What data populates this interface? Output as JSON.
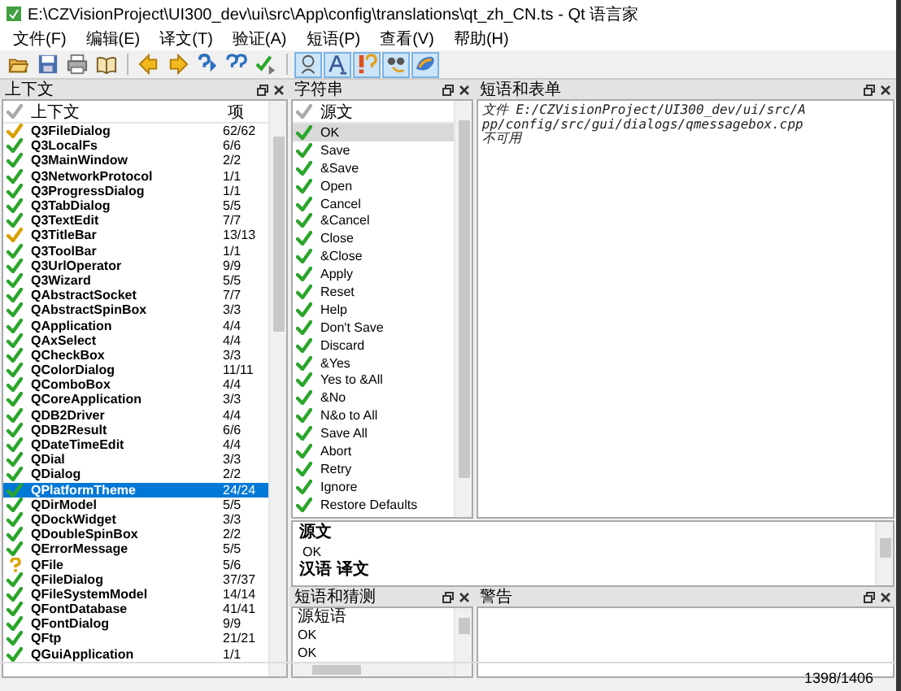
{
  "window": {
    "title": "E:\\CZVisionProject\\UI300_dev\\ui\\src\\App\\config\\translations\\qt_zh_CN.ts - Qt 语言家"
  },
  "menu": [
    "文件(F)",
    "编辑(E)",
    "译文(T)",
    "验证(A)",
    "短语(P)",
    "查看(V)",
    "帮助(H)"
  ],
  "toolbar": [
    [
      {
        "kind": "open",
        "on": false
      },
      {
        "kind": "save",
        "on": false
      },
      {
        "kind": "print",
        "on": false
      },
      {
        "kind": "book",
        "on": false
      }
    ],
    [
      {
        "kind": "prev",
        "on": false
      },
      {
        "kind": "next",
        "on": false
      },
      {
        "kind": "prev_unfinished",
        "on": false
      },
      {
        "kind": "next_unfinished",
        "on": false
      },
      {
        "kind": "done_next",
        "on": false
      }
    ],
    [
      {
        "kind": "accelerators",
        "on": true
      },
      {
        "kind": "punctuation",
        "on": true
      },
      {
        "kind": "phrases",
        "on": true
      },
      {
        "kind": "markers",
        "on": true
      },
      {
        "kind": "whitespace",
        "on": true
      }
    ]
  ],
  "context": {
    "title": "上下文",
    "columns": [
      "上下文",
      "项"
    ],
    "rows": [
      {
        "name": "Q3FileDialog",
        "count": "62/62",
        "kind": "warning",
        "selected": false
      },
      {
        "name": "Q3LocalFs",
        "count": "6/6",
        "kind": "done",
        "selected": false
      },
      {
        "name": "Q3MainWindow",
        "count": "2/2",
        "kind": "done",
        "selected": false
      },
      {
        "name": "Q3NetworkProtocol",
        "count": "1/1",
        "kind": "done",
        "selected": false
      },
      {
        "name": "Q3ProgressDialog",
        "count": "1/1",
        "kind": "done",
        "selected": false
      },
      {
        "name": "Q3TabDialog",
        "count": "5/5",
        "kind": "done",
        "selected": false
      },
      {
        "name": "Q3TextEdit",
        "count": "7/7",
        "kind": "done",
        "selected": false
      },
      {
        "name": "Q3TitleBar",
        "count": "13/13",
        "kind": "warning",
        "selected": false
      },
      {
        "name": "Q3ToolBar",
        "count": "1/1",
        "kind": "done",
        "selected": false
      },
      {
        "name": "Q3UrlOperator",
        "count": "9/9",
        "kind": "done",
        "selected": false
      },
      {
        "name": "Q3Wizard",
        "count": "5/5",
        "kind": "done",
        "selected": false
      },
      {
        "name": "QAbstractSocket",
        "count": "7/7",
        "kind": "done",
        "selected": false
      },
      {
        "name": "QAbstractSpinBox",
        "count": "3/3",
        "kind": "done",
        "selected": false
      },
      {
        "name": "QApplication",
        "count": "4/4",
        "kind": "done",
        "selected": false
      },
      {
        "name": "QAxSelect",
        "count": "4/4",
        "kind": "done",
        "selected": false
      },
      {
        "name": "QCheckBox",
        "count": "3/3",
        "kind": "done",
        "selected": false
      },
      {
        "name": "QColorDialog",
        "count": "11/11",
        "kind": "done",
        "selected": false
      },
      {
        "name": "QComboBox",
        "count": "4/4",
        "kind": "done",
        "selected": false
      },
      {
        "name": "QCoreApplication",
        "count": "3/3",
        "kind": "done",
        "selected": false
      },
      {
        "name": "QDB2Driver",
        "count": "4/4",
        "kind": "done",
        "selected": false
      },
      {
        "name": "QDB2Result",
        "count": "6/6",
        "kind": "done",
        "selected": false
      },
      {
        "name": "QDateTimeEdit",
        "count": "4/4",
        "kind": "done",
        "selected": false
      },
      {
        "name": "QDial",
        "count": "3/3",
        "kind": "done",
        "selected": false
      },
      {
        "name": "QDialog",
        "count": "2/2",
        "kind": "done",
        "selected": false
      },
      {
        "name": "QPlatformTheme",
        "count": "24/24",
        "kind": "done",
        "selected": true
      },
      {
        "name": "QDirModel",
        "count": "5/5",
        "kind": "done",
        "selected": false
      },
      {
        "name": "QDockWidget",
        "count": "3/3",
        "kind": "done",
        "selected": false
      },
      {
        "name": "QDoubleSpinBox",
        "count": "2/2",
        "kind": "done",
        "selected": false
      },
      {
        "name": "QErrorMessage",
        "count": "5/5",
        "kind": "done",
        "selected": false
      },
      {
        "name": "QFile",
        "count": "5/6",
        "kind": "unknown",
        "selected": false
      },
      {
        "name": "QFileDialog",
        "count": "37/37",
        "kind": "done",
        "selected": false
      },
      {
        "name": "QFileSystemModel",
        "count": "14/14",
        "kind": "done",
        "selected": false
      },
      {
        "name": "QFontDatabase",
        "count": "41/41",
        "kind": "done",
        "selected": false
      },
      {
        "name": "QFontDialog",
        "count": "9/9",
        "kind": "done",
        "selected": false
      },
      {
        "name": "QFtp",
        "count": "21/21",
        "kind": "done",
        "selected": false
      },
      {
        "name": "QGuiApplication",
        "count": "1/1",
        "kind": "done",
        "selected": false
      }
    ]
  },
  "strings": {
    "title": "字符串",
    "column": "源文",
    "rows": [
      {
        "text": "OK",
        "kind": "done",
        "selected": true
      },
      {
        "text": "Save",
        "kind": "done",
        "selected": false
      },
      {
        "text": "&Save",
        "kind": "done",
        "selected": false
      },
      {
        "text": "Open",
        "kind": "done",
        "selected": false
      },
      {
        "text": "Cancel",
        "kind": "done",
        "selected": false
      },
      {
        "text": "&Cancel",
        "kind": "done",
        "selected": false
      },
      {
        "text": "Close",
        "kind": "done",
        "selected": false
      },
      {
        "text": "&Close",
        "kind": "done",
        "selected": false
      },
      {
        "text": "Apply",
        "kind": "done",
        "selected": false
      },
      {
        "text": "Reset",
        "kind": "done",
        "selected": false
      },
      {
        "text": "Help",
        "kind": "done",
        "selected": false
      },
      {
        "text": "Don't Save",
        "kind": "done",
        "selected": false
      },
      {
        "text": "Discard",
        "kind": "done",
        "selected": false
      },
      {
        "text": "&Yes",
        "kind": "done",
        "selected": false
      },
      {
        "text": "Yes to &All",
        "kind": "done",
        "selected": false
      },
      {
        "text": "&No",
        "kind": "done",
        "selected": false
      },
      {
        "text": "N&o to All",
        "kind": "done",
        "selected": false
      },
      {
        "text": "Save All",
        "kind": "done",
        "selected": false
      },
      {
        "text": "Abort",
        "kind": "done",
        "selected": false
      },
      {
        "text": "Retry",
        "kind": "done",
        "selected": false
      },
      {
        "text": "Ignore",
        "kind": "done",
        "selected": false
      },
      {
        "text": "Restore Defaults",
        "kind": "done",
        "selected": false
      }
    ]
  },
  "phrases_forms": {
    "title": "短语和表单",
    "message": "文件 E:/CZVisionProject/UI300_dev/ui/src/App/config/src/gui/dialogs/qmessagebox.cpp 不可用"
  },
  "editor": {
    "source_label": "源文",
    "source_text": "OK",
    "translation_label": "汉语 译文"
  },
  "phrase_guesses": {
    "title": "短语和猜测",
    "column": "源短语",
    "rows": [
      "OK",
      "OK"
    ]
  },
  "warnings": {
    "title": "警告"
  },
  "status_bar": "1398/1406"
}
